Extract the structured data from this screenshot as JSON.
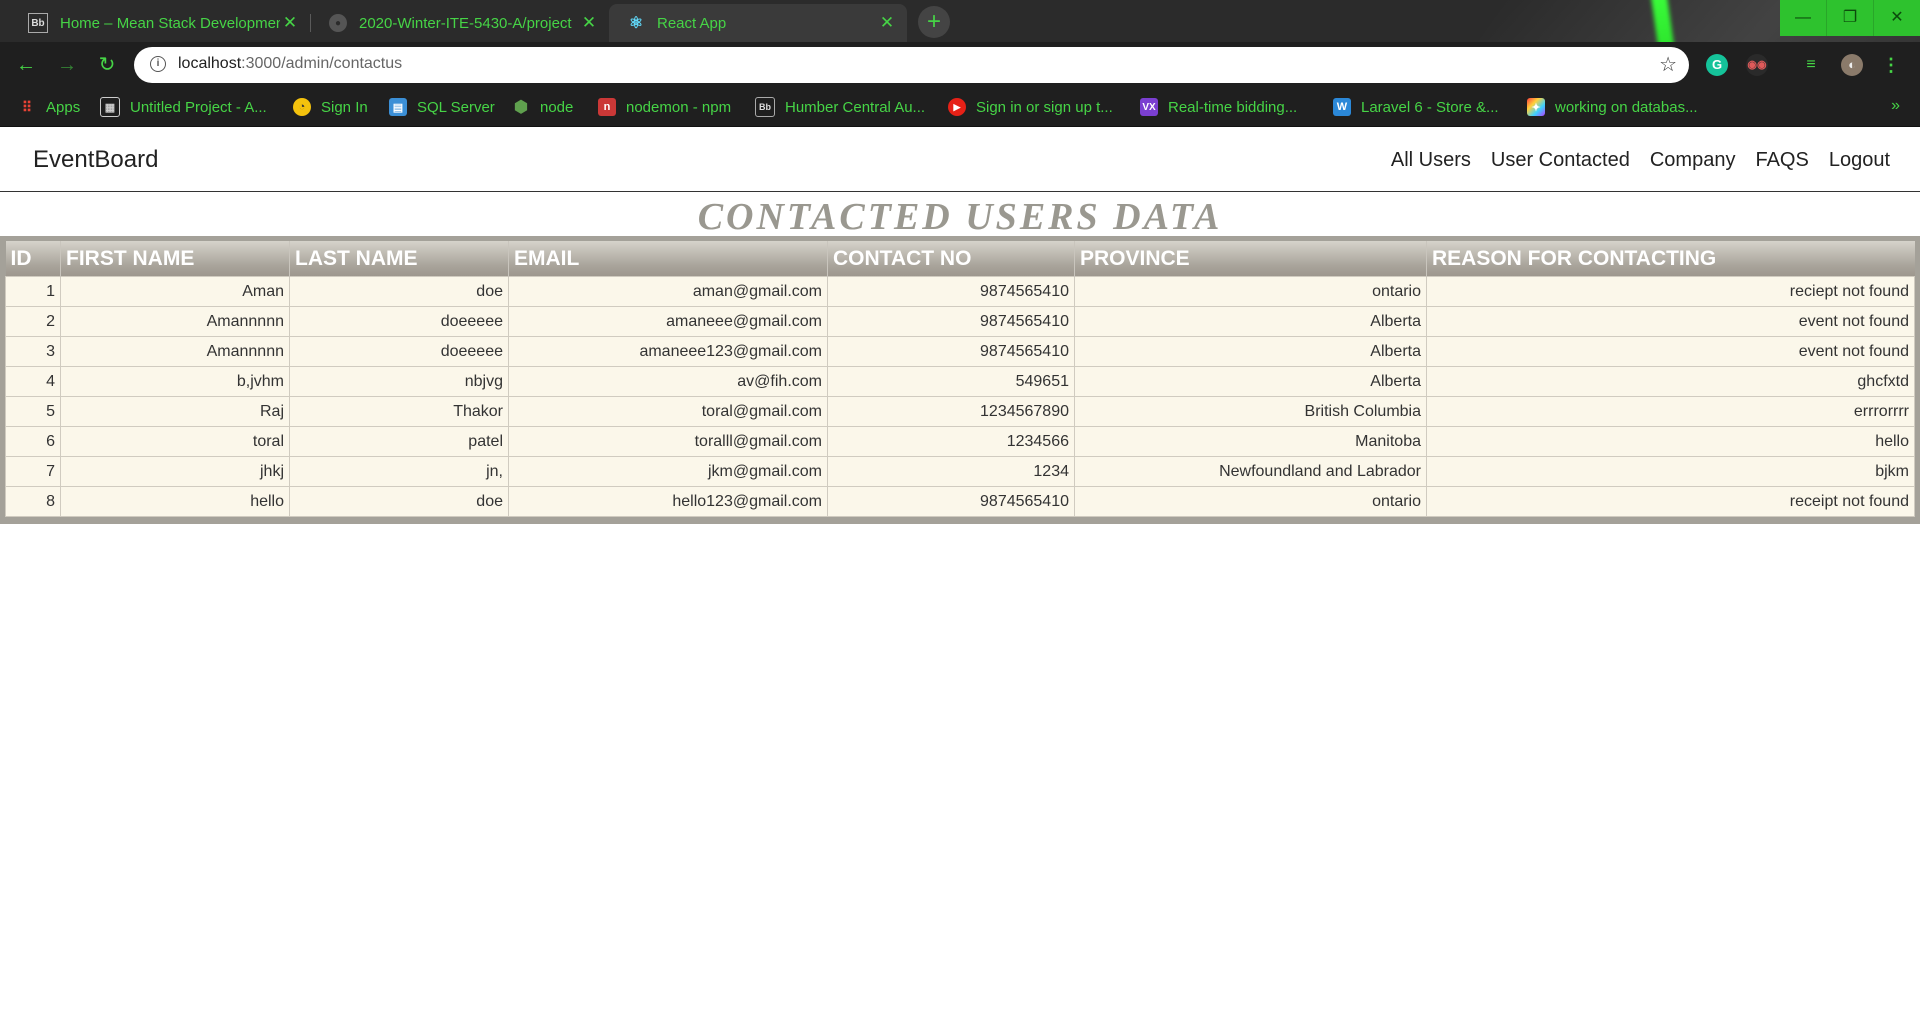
{
  "browser": {
    "tabs": [
      {
        "title": "Home – Mean Stack Developmen",
        "favicon": "bb-icon"
      },
      {
        "title": "2020-Winter-ITE-5430-A/project",
        "favicon": "github-icon"
      },
      {
        "title": "React App",
        "favicon": "react-icon"
      }
    ],
    "url": {
      "host": "localhost",
      "rest": ":3000/admin/contactus"
    },
    "bookmarks": [
      {
        "label": "Apps",
        "icon": "apps-grid-icon",
        "color": "#e94235"
      },
      {
        "label": "Untitled Project - A...",
        "icon": "grid-icon",
        "color": "#cccccc"
      },
      {
        "label": "Sign In",
        "icon": "signin-icon",
        "color": "#f4c20d"
      },
      {
        "label": "SQL Server",
        "icon": "sqlserver-icon",
        "color": "#3b8fd6"
      },
      {
        "label": "node",
        "icon": "node-icon",
        "color": "#5fa04e"
      },
      {
        "label": "nodemon - npm",
        "icon": "npm-icon",
        "color": "#cb3837"
      },
      {
        "label": "Humber Central Au...",
        "icon": "bb-icon",
        "color": "#dddddd"
      },
      {
        "label": "Sign in or sign up t...",
        "icon": "play-icon",
        "color": "#e62117"
      },
      {
        "label": "Real-time bidding...",
        "icon": "vx-icon",
        "color": "#7b3fd1"
      },
      {
        "label": "Laravel 6 - Store &...",
        "icon": "w-icon",
        "color": "#2b88d8"
      },
      {
        "label": "working on databas...",
        "icon": "colorful-icon",
        "color": "#d63aff"
      }
    ]
  },
  "app": {
    "brand": "EventBoard",
    "nav": [
      "All Users",
      "User Contacted",
      "Company",
      "FAQS",
      "Logout"
    ],
    "heading": "CONTACTED USERS DATA",
    "table": {
      "headers": [
        "ID",
        "FIRST NAME",
        "LAST NAME",
        "EMAIL",
        "CONTACT NO",
        "PROVINCE",
        "REASON FOR CONTACTING"
      ],
      "rows": [
        [
          "1",
          "Aman",
          "doe",
          "aman@gmail.com",
          "9874565410",
          "ontario",
          "reciept not found"
        ],
        [
          "2",
          "Amannnnn",
          "doeeeee",
          "amaneee@gmail.com",
          "9874565410",
          "Alberta",
          "event not found"
        ],
        [
          "3",
          "Amannnnn",
          "doeeeee",
          "amaneee123@gmail.com",
          "9874565410",
          "Alberta",
          "event not found"
        ],
        [
          "4",
          "b,jvhm",
          "nbjvg",
          "av@fih.com",
          "549651",
          "Alberta",
          "ghcfxtd"
        ],
        [
          "5",
          "Raj",
          "Thakor",
          "toral@gmail.com",
          "1234567890",
          "British Columbia",
          "errrorrrr"
        ],
        [
          "6",
          "toral",
          "patel",
          "toralll@gmail.com",
          "1234566",
          "Manitoba",
          "hello"
        ],
        [
          "7",
          "jhkj",
          "jn,",
          "jkm@gmail.com",
          "1234",
          "Newfoundland and Labrador",
          "bjkm"
        ],
        [
          "8",
          "hello",
          "doe",
          "hello123@gmail.com",
          "9874565410",
          "ontario",
          "receipt not found"
        ]
      ]
    }
  },
  "colors": {
    "accent": "#46d446",
    "header_bg": "#a9a49b",
    "row_bg": "#fbf7ea",
    "heading": "#9a9890"
  }
}
